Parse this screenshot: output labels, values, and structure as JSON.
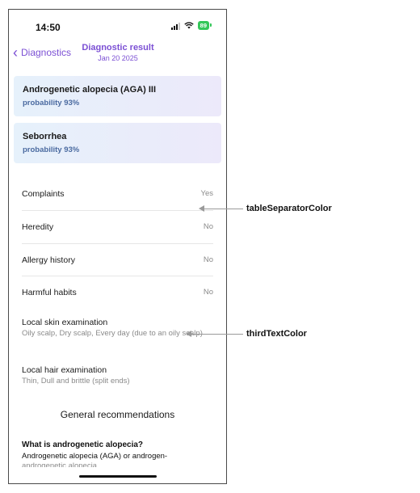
{
  "status_bar": {
    "time": "14:50",
    "battery": "89"
  },
  "nav": {
    "back_label": "Diagnostics",
    "title": "Diagnostic result",
    "date": "Jan 20 2025"
  },
  "diagnoses": [
    {
      "title": "Androgenetic alopecia (AGA) III",
      "probability": "probability 93%"
    },
    {
      "title": "Seborrhea",
      "probability": "probability 93%"
    }
  ],
  "history_rows": [
    {
      "label": "Complaints",
      "value": "Yes"
    },
    {
      "label": "Heredity",
      "value": "No"
    },
    {
      "label": "Allergy history",
      "value": "No"
    },
    {
      "label": "Harmful habits",
      "value": "No"
    }
  ],
  "examinations": [
    {
      "title": "Local skin examination",
      "text": "Oily scalp, Dry scalp, Every day (due to an oily scalp)"
    },
    {
      "title": "Local hair examination",
      "text": "Thin, Dull and brittle (split ends)"
    }
  ],
  "recommendations": {
    "title": "General recommendations",
    "question": "What is androgenetic alopecia?",
    "answer": "Androgenetic alopecia (AGA) or androgen-"
  },
  "annotations": [
    {
      "label": "tableSeparatorColor"
    },
    {
      "label": "thirdTextColor"
    }
  ],
  "colors": {
    "accent": "#7b4fd4",
    "separator": "#e6e6e6",
    "third_text": "#8a8a8a"
  }
}
